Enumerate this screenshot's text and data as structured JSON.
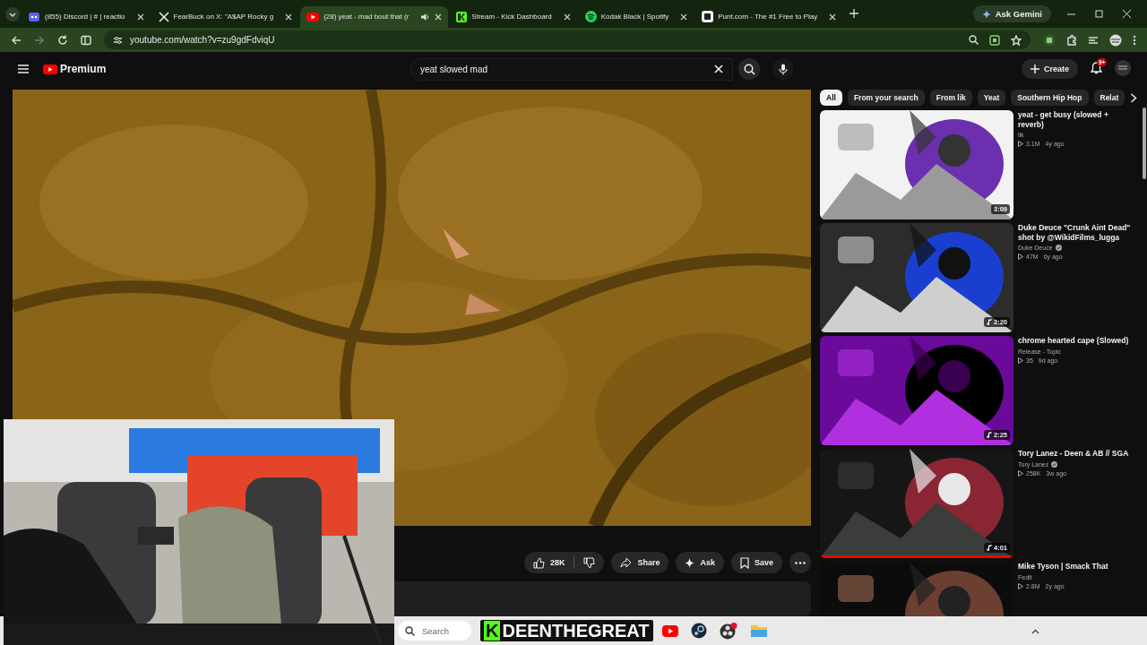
{
  "browser": {
    "tabs": [
      {
        "title": "(855) Discord | # | reactio",
        "selected": false,
        "kind": "discord",
        "audio": false
      },
      {
        "title": "FearBuck on X: \"A$AP Rocky g",
        "selected": false,
        "kind": "x",
        "audio": false
      },
      {
        "title": "(28) yeat - mad bout that (r",
        "selected": true,
        "kind": "youtube",
        "audio": true
      },
      {
        "title": "Stream - Kick Dashboard",
        "selected": false,
        "kind": "kick",
        "audio": false
      },
      {
        "title": "Kodak Black | Spotify",
        "selected": false,
        "kind": "spotify",
        "audio": false
      },
      {
        "title": "Punt.com - The #1 Free to Play",
        "selected": false,
        "kind": "punt",
        "audio": false
      }
    ],
    "ask_button": "Ask Gemini",
    "url": "youtube.com/watch?v=zu9gdFdviqU"
  },
  "youtube": {
    "logo": "Premium",
    "search": {
      "value": "yeat slowed mad"
    },
    "create": "Create",
    "notifications": "9+",
    "actions": {
      "likes": "28K",
      "share": "Share",
      "ask": "Ask",
      "save": "Save"
    },
    "chips": [
      {
        "label": "All",
        "selected": true
      },
      {
        "label": "From your search",
        "selected": false
      },
      {
        "label": "From lik",
        "selected": false
      },
      {
        "label": "Yeat",
        "selected": false
      },
      {
        "label": "Southern Hip Hop",
        "selected": false
      },
      {
        "label": "Relat",
        "selected": false
      }
    ],
    "videos": [
      {
        "title": "yeat - get busy (slowed + reverb)",
        "channel": "lik",
        "verified": false,
        "views": "3.1M",
        "age": "4y ago",
        "duration": "3:09",
        "music": false
      },
      {
        "title": "Duke Deuce \"Crunk Aint Dead\" shot by @WikidFilms_lugga",
        "channel": "Duke Deuce",
        "verified": true,
        "views": "47M",
        "age": "6y ago",
        "duration": "2:20",
        "music": true
      },
      {
        "title": "chrome hearted cape (Slowed)",
        "channel": "Release - Topic",
        "verified": false,
        "views": "35",
        "age": "9d ago",
        "duration": "2:25",
        "music": true
      },
      {
        "title": "Tory Lanez - Deen & AB // SGA",
        "channel": "Tory Lanez",
        "verified": true,
        "views": "258K",
        "age": "3w ago",
        "duration": "4:01",
        "music": true,
        "level": 1
      },
      {
        "title": "Mike Tyson | Smack That",
        "channel": "Fedit",
        "verified": false,
        "views": "2.8M",
        "age": "2y ago"
      }
    ]
  },
  "overlay": {
    "badge": "K",
    "name": "DEENTHEGREAT"
  },
  "taskbar": {
    "search": {
      "placeholder": "Search"
    }
  }
}
